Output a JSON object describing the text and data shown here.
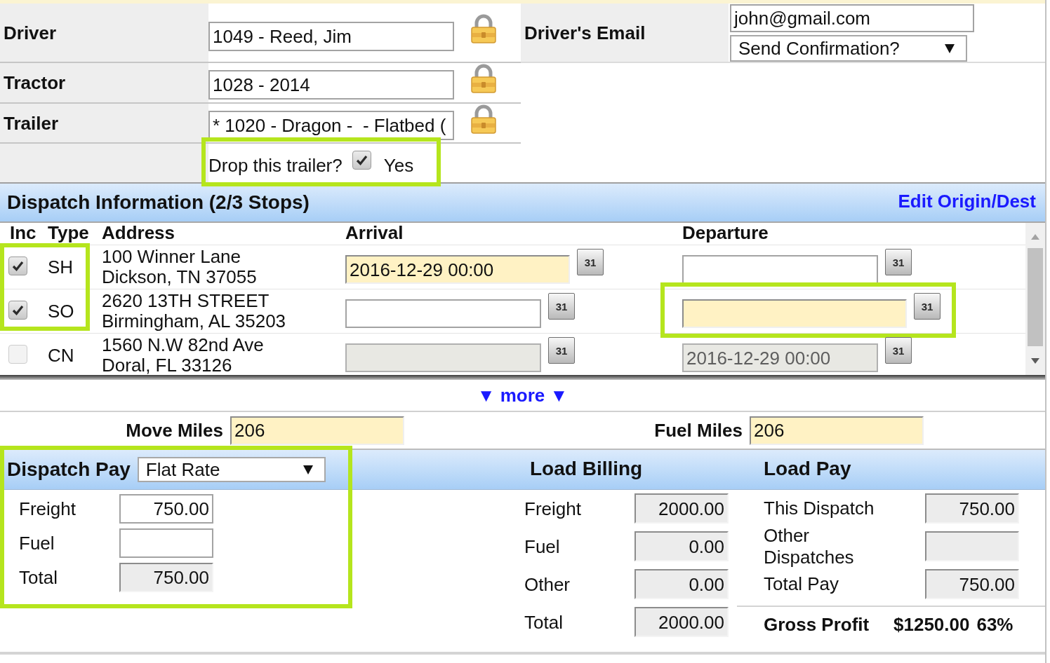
{
  "driver_section": {
    "fields": [
      {
        "label": "Driver",
        "value": "1049 - Reed, Jim",
        "locked": true
      },
      {
        "label": "Tractor",
        "value": "1028 - 2014",
        "locked": true
      },
      {
        "label": "Trailer",
        "value": "* 1020 - Dragon -  - Flatbed (",
        "locked": true
      }
    ],
    "drop_trailer": {
      "label": "Drop this trailer?",
      "checked": true,
      "option": "Yes",
      "highlighted": true
    },
    "email": {
      "label": "Driver's Email",
      "value": "john@gmail.com",
      "select": "Send Confirmation?"
    }
  },
  "dispatch_info": {
    "title": "Dispatch Information (2/3 Stops)",
    "edit_link": "Edit Origin/Dest",
    "columns": [
      "Inc",
      "Type",
      "Address",
      "Arrival",
      "Departure"
    ],
    "stops": [
      {
        "included": true,
        "inc_highlighted": true,
        "type": "SH",
        "address": [
          "100 Winner Lane",
          "Dickson, TN 37055"
        ],
        "arrival": {
          "value": "2016-12-29 00:00",
          "required": true,
          "disabled": false,
          "highlighted": false,
          "calendar": "31"
        },
        "departure": {
          "required": false,
          "disabled": false,
          "highlighted": false,
          "calendar": "31"
        }
      },
      {
        "included": true,
        "inc_highlighted": true,
        "type": "SO",
        "address": [
          "2620 13TH STREET",
          "Birmingham, AL 35203"
        ],
        "arrival": {
          "required": false,
          "disabled": false,
          "highlighted": false,
          "calendar": "31"
        },
        "departure": {
          "required": true,
          "disabled": false,
          "highlighted": true,
          "calendar": "31"
        }
      },
      {
        "included": false,
        "inc_highlighted": false,
        "type": "CN",
        "address": [
          "1560 N.W 82nd Ave",
          "Doral, FL 33126"
        ],
        "arrival": {
          "required": false,
          "disabled": true,
          "highlighted": false,
          "calendar": "31"
        },
        "departure": {
          "value": "2016-12-29 00:00",
          "required": false,
          "disabled": true,
          "highlighted": false,
          "calendar": "31"
        }
      }
    ],
    "more_link": "▼ more ▼"
  },
  "miles": [
    {
      "label": "Move Miles",
      "value": "206",
      "required": true
    },
    {
      "label": "Fuel Miles",
      "value": "206",
      "required": true
    }
  ],
  "dispatch_pay": {
    "title": "Dispatch Pay",
    "rate": "Flat Rate",
    "highlighted": true,
    "rows": [
      {
        "label": "Freight",
        "value": "750.00",
        "readonly": false
      },
      {
        "label": "Fuel",
        "readonly": false
      },
      {
        "label": "Total",
        "value": "750.00",
        "readonly": true
      }
    ]
  },
  "load_billing": {
    "title": "Load Billing",
    "rows": [
      {
        "label": "Freight",
        "value": "2000.00",
        "readonly": true
      },
      {
        "label": "Fuel",
        "value": "0.00",
        "readonly": true
      },
      {
        "label": "Other",
        "value": "0.00",
        "readonly": true
      },
      {
        "label": "Total",
        "value": "2000.00",
        "readonly": true
      }
    ]
  },
  "load_pay": {
    "title": "Load Pay",
    "rows": [
      {
        "label": "This Dispatch",
        "value": "750.00",
        "readonly": true
      },
      {
        "label": "Other Dispatches",
        "readonly": true
      },
      {
        "label": "Total Pay",
        "value": "750.00",
        "readonly": true
      }
    ],
    "gross_profit": {
      "label": "Gross Profit",
      "amount": "$1250.00",
      "percent": "63%"
    }
  }
}
